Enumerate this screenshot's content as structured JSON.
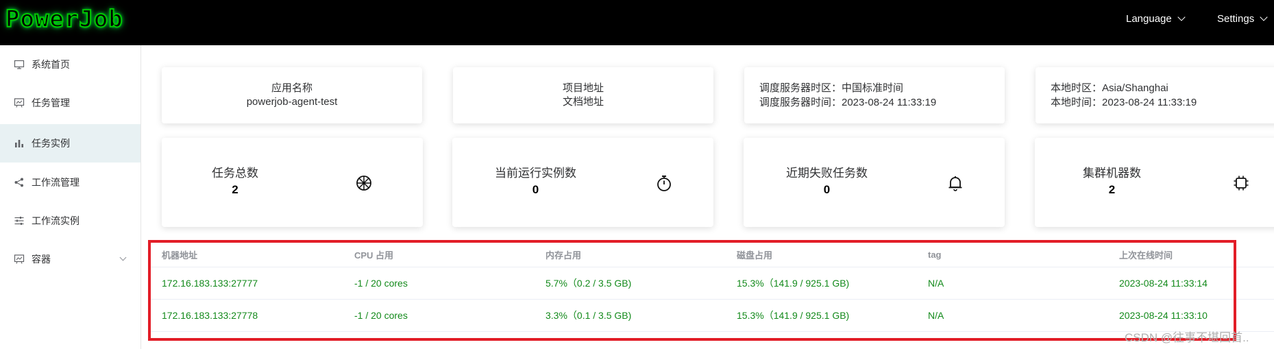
{
  "header": {
    "logo": "PowerJob",
    "language": "Language",
    "settings": "Settings"
  },
  "sidebar": {
    "items": [
      {
        "label": "系统首页",
        "icon": "monitor-icon"
      },
      {
        "label": "任务管理",
        "icon": "task-board-icon"
      },
      {
        "label": "任务实例",
        "icon": "bar-chart-icon"
      },
      {
        "label": "工作流管理",
        "icon": "share-icon"
      },
      {
        "label": "工作流实例",
        "icon": "sliders-icon"
      },
      {
        "label": "容器",
        "icon": "container-icon"
      }
    ],
    "active_index": 2
  },
  "info": {
    "app_name_label": "应用名称",
    "app_name": "powerjob-agent-test",
    "project_link": "项目地址",
    "docs_link": "文档地址",
    "server_tz_line": "调度服务器时区：中国标准时间",
    "server_time_line": "调度服务器时间：2023-08-24 11:33:19",
    "local_tz_line": "本地时区：Asia/Shanghai",
    "local_time_line": "本地时间：2023-08-24 11:33:19"
  },
  "stats": [
    {
      "title": "任务总数",
      "value": "2",
      "icon": "wheel-icon"
    },
    {
      "title": "当前运行实例数",
      "value": "0",
      "icon": "stopwatch-icon"
    },
    {
      "title": "近期失败任务数",
      "value": "0",
      "icon": "bell-icon"
    },
    {
      "title": "集群机器数",
      "value": "2",
      "icon": "chip-icon"
    }
  ],
  "table": {
    "columns": [
      "机器地址",
      "CPU 占用",
      "内存占用",
      "磁盘占用",
      "tag",
      "上次在线时间"
    ],
    "rows": [
      [
        "172.16.183.133:27777",
        "-1 / 20 cores",
        "5.7%（0.2 / 3.5 GB)",
        "15.3%（141.9 / 925.1 GB)",
        "N/A",
        "2023-08-24 11:33:14"
      ],
      [
        "172.16.183.133:27778",
        "-1 / 20 cores",
        "3.3%（0.1 / 3.5 GB)",
        "15.3%（141.9 / 925.1 GB)",
        "N/A",
        "2023-08-24 11:33:10"
      ]
    ]
  },
  "watermark": "CSDN @往事不堪回首..",
  "colors": {
    "header_bg": "#000000",
    "logo_green": "#00c800",
    "active_bg": "#e8f1f3",
    "table_text_green": "#138a1b",
    "highlight_red": "#e21d27"
  }
}
